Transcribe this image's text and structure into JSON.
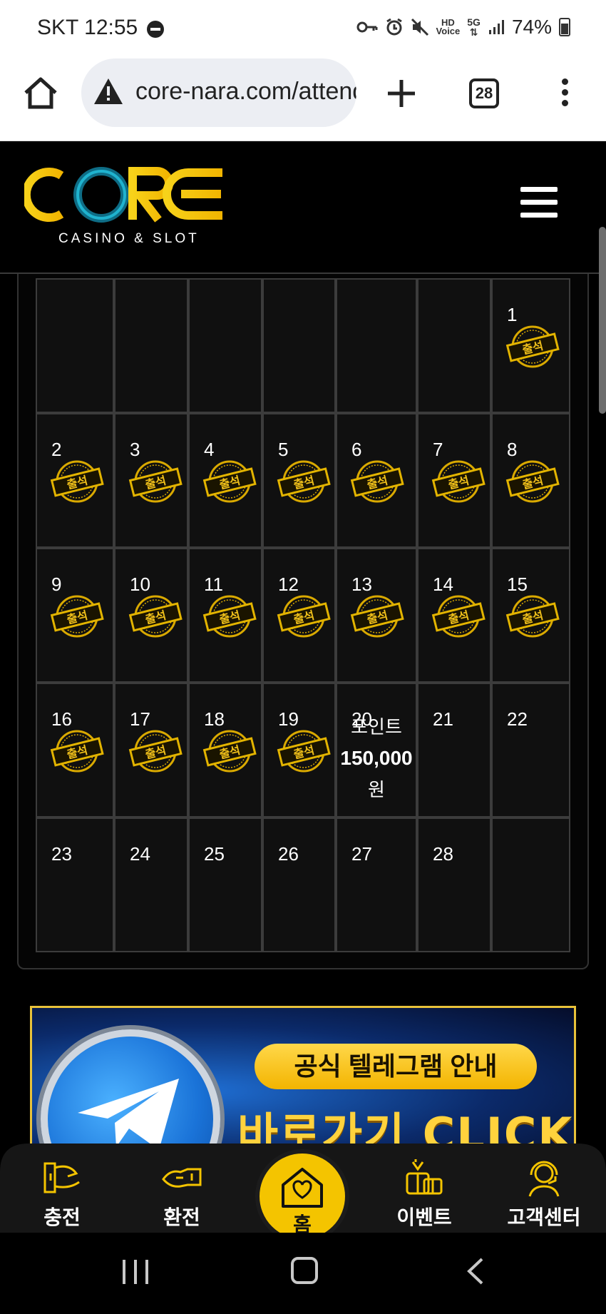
{
  "status_bar": {
    "carrier_time": "SKT 12:55",
    "battery": "74%",
    "icons": [
      "dnd-icon",
      "key-icon",
      "alarm-icon",
      "mute-icon",
      "hd-voice-icon",
      "5g-icon",
      "signal-icon",
      "battery-icon"
    ]
  },
  "browser": {
    "url": "core-nara.com/attendance",
    "tab_count": "28"
  },
  "site": {
    "logo_text": "CORE",
    "logo_sub": "CASINO & SLOT"
  },
  "calendar": {
    "stamp_label": "출석",
    "reward": {
      "line1": "포인트",
      "amount": "150,000",
      "unit": "원"
    },
    "weeks": [
      [
        null,
        null,
        null,
        null,
        null,
        null,
        {
          "day": "1",
          "stamp": true
        }
      ],
      [
        {
          "day": "2",
          "stamp": true
        },
        {
          "day": "3",
          "stamp": true
        },
        {
          "day": "4",
          "stamp": true
        },
        {
          "day": "5",
          "stamp": true
        },
        {
          "day": "6",
          "stamp": true
        },
        {
          "day": "7",
          "stamp": true
        },
        {
          "day": "8",
          "stamp": true
        }
      ],
      [
        {
          "day": "9",
          "stamp": true
        },
        {
          "day": "10",
          "stamp": true
        },
        {
          "day": "11",
          "stamp": true
        },
        {
          "day": "12",
          "stamp": true
        },
        {
          "day": "13",
          "stamp": true
        },
        {
          "day": "14",
          "stamp": true
        },
        {
          "day": "15",
          "stamp": true
        }
      ],
      [
        {
          "day": "16",
          "stamp": true
        },
        {
          "day": "17",
          "stamp": true
        },
        {
          "day": "18",
          "stamp": true
        },
        {
          "day": "19",
          "stamp": true
        },
        {
          "day": "20",
          "stamp": false,
          "reward": true
        },
        {
          "day": "21",
          "stamp": false
        },
        {
          "day": "22",
          "stamp": false
        }
      ],
      [
        {
          "day": "23",
          "stamp": false
        },
        {
          "day": "24",
          "stamp": false
        },
        {
          "day": "25",
          "stamp": false
        },
        {
          "day": "26",
          "stamp": false
        },
        {
          "day": "27",
          "stamp": false
        },
        {
          "day": "28",
          "stamp": false
        },
        null
      ]
    ]
  },
  "banner": {
    "pill": "공식 텔레그램 안내",
    "cta": "바로가기 CLICK"
  },
  "bottom_nav": {
    "deposit": "충전",
    "withdraw": "환전",
    "home": "홈",
    "event": "이벤트",
    "support": "고객센터"
  },
  "colors": {
    "accent": "#f4c400",
    "stamp_gold": "#d9a900",
    "background": "#000000"
  }
}
